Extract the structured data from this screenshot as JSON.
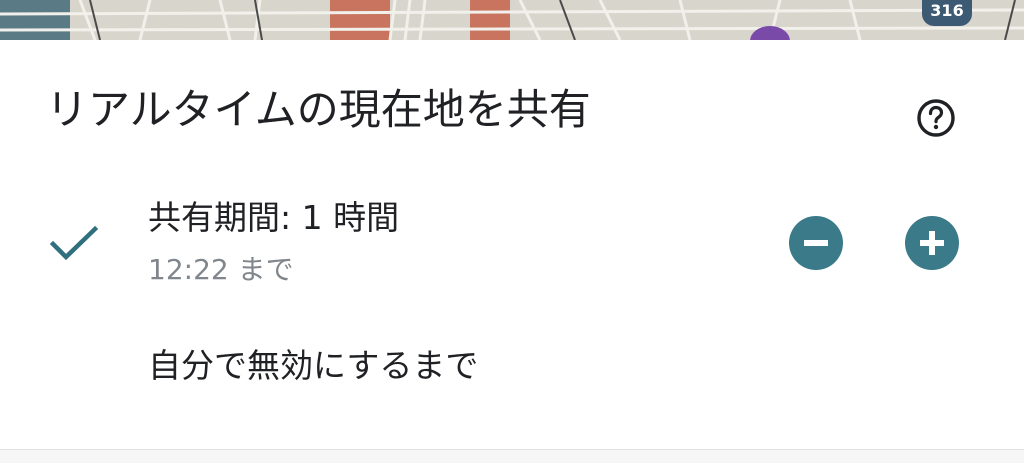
{
  "map": {
    "route_badge": "316"
  },
  "sheet": {
    "title": "リアルタイムの現在地を共有",
    "help_icon": "help-circle-icon",
    "duration": {
      "label": "共有期間: 1 時間",
      "until_text": "12:22 まで",
      "selected": true,
      "check_icon": "check-icon",
      "minus_icon": "minus-icon",
      "plus_icon": "plus-icon"
    },
    "option_until_off": {
      "label": "自分で無効にするまで"
    }
  },
  "colors": {
    "accent": "#3a7a89",
    "check": "#2f6f7e",
    "title_text": "#202124",
    "secondary_text": "#80868b"
  }
}
